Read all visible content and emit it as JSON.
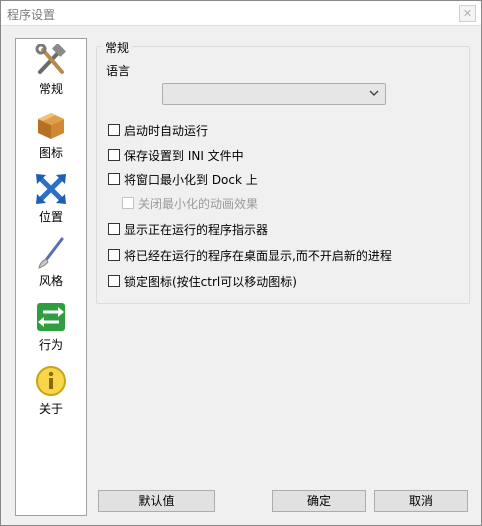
{
  "window": {
    "title": "程序设置",
    "close": "✕"
  },
  "sidebar": {
    "items": [
      {
        "label": "常规",
        "icon": "tools-icon"
      },
      {
        "label": "图标",
        "icon": "box-icon"
      },
      {
        "label": "位置",
        "icon": "arrows-icon"
      },
      {
        "label": "风格",
        "icon": "brush-icon"
      },
      {
        "label": "行为",
        "icon": "switch-arrows-icon"
      },
      {
        "label": "关于",
        "icon": "info-icon"
      }
    ]
  },
  "general": {
    "group_title": "常规",
    "language_label": "语言",
    "language_value": "",
    "options": [
      {
        "label": "启动时自动运行",
        "checked": false,
        "disabled": false
      },
      {
        "label": "保存设置到 INI 文件中",
        "checked": false,
        "disabled": false
      },
      {
        "label": "将窗口最小化到 Dock 上",
        "checked": false,
        "disabled": false
      },
      {
        "label": "关闭最小化的动画效果",
        "checked": false,
        "disabled": true
      },
      {
        "label": "显示正在运行的程序指示器",
        "checked": false,
        "disabled": false
      },
      {
        "label": "将已经在运行的程序在桌面显示,而不开启新的进程",
        "checked": false,
        "disabled": false
      },
      {
        "label": "锁定图标(按住ctrl可以移动图标)",
        "checked": false,
        "disabled": false
      }
    ]
  },
  "buttons": {
    "default": "默认值",
    "ok": "确定",
    "cancel": "取消"
  }
}
